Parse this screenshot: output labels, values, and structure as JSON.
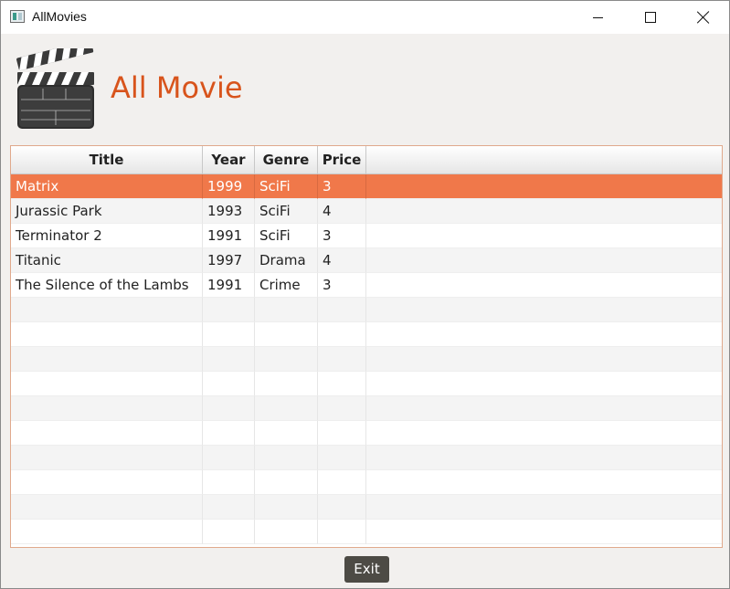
{
  "window": {
    "title": "AllMovies"
  },
  "header": {
    "heading": "All Movie",
    "logo_icon": "clapperboard-icon"
  },
  "table": {
    "columns": [
      "Title",
      "Year",
      "Genre",
      "Price"
    ],
    "rows": [
      {
        "title": "Matrix",
        "year": "1999",
        "genre": "SciFi",
        "price": "3",
        "selected": true
      },
      {
        "title": "Jurassic Park",
        "year": "1993",
        "genre": "SciFi",
        "price": "4",
        "selected": false
      },
      {
        "title": "Terminator 2",
        "year": "1991",
        "genre": "SciFi",
        "price": "3",
        "selected": false
      },
      {
        "title": "Titanic",
        "year": "1997",
        "genre": "Drama",
        "price": "4",
        "selected": false
      },
      {
        "title": "The Silence of the Lambs",
        "year": "1991",
        "genre": "Crime",
        "price": "3",
        "selected": false
      }
    ]
  },
  "footer": {
    "exit_label": "Exit"
  },
  "colors": {
    "accent": "#f0784a",
    "heading": "#d8541c",
    "button": "#4d4b45"
  }
}
